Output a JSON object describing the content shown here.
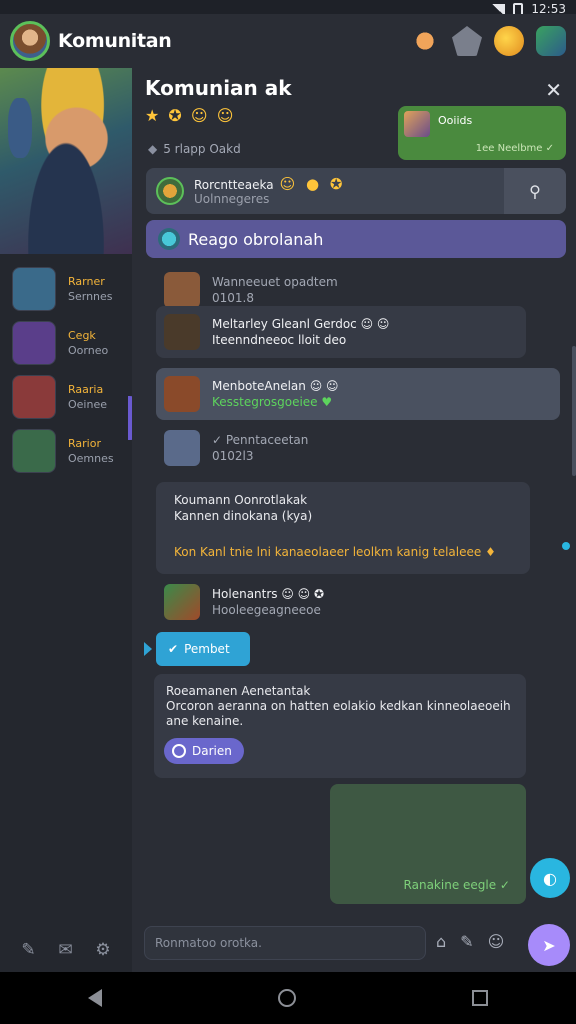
{
  "status": {
    "time": "12:53"
  },
  "header": {
    "title": "Komunitan"
  },
  "rail": {
    "items": [
      {
        "name": "Rarner",
        "sub": "Sernnes",
        "color": "#3a6a8a"
      },
      {
        "name": "Cegk",
        "sub": "Oorneo",
        "color": "#5a3e8a"
      },
      {
        "name": "Raaria",
        "sub": "Oeinee",
        "color": "#8a3a3a"
      },
      {
        "name": "Rarior",
        "sub": "Oemnes",
        "color": "#3a6a4a"
      }
    ]
  },
  "panel": {
    "title": "Komunian ak",
    "stars": "★ ✪ ☺ ☺",
    "meta": "5 rlapp Oakd",
    "top_card": {
      "title": "Ooiids",
      "sub": "1ee Neelbme ✓"
    },
    "search_row": {
      "name": "Rorcntteaeka",
      "sub": "Uolnnegeres",
      "emojis": "☺ ● ✪"
    },
    "group_bar": "Reago obrolanah",
    "messages": [
      {
        "name": "Wanneeuet opadtem",
        "sub": "0101.8",
        "color": "#8a5a3a"
      },
      {
        "name": "Meltarley Gleanl Gerdoc ☺ ☺",
        "sub": "Iteenndneeoc lloit deo",
        "color": "#4a3a2a"
      },
      {
        "name": "MenboteAnelan ☺ ☺",
        "sub": "Kesstegrosgoeiee ♥",
        "color": "#8a4a2a"
      },
      {
        "name": "✓ Penntaceetan",
        "sub": "0102l3",
        "color": "#5a6a8a"
      }
    ],
    "text_card": {
      "line1": "Koumann Oonrotlakak",
      "line2": "Kannen dinokana (kya)",
      "line3": "Kon Kanl tnie lni kanaeolaeer leolkm kanig telaleee ♦"
    },
    "tagged_msg": {
      "name": "Holenantrs ☺ ☺ ✪",
      "sub": "Hooleegeagneeoe"
    },
    "pill": "Pembet",
    "info_card": {
      "line1": "Roeamanen Aenetantak",
      "line2": "Orcoron aeranna on hatten eolakio kedkan kinneolaeoeih",
      "line3": "ane kenaine.",
      "button": "Darien"
    },
    "green_card": "Ranakine eegle ✓",
    "compose_placeholder": "Ronmatoo orotka."
  }
}
